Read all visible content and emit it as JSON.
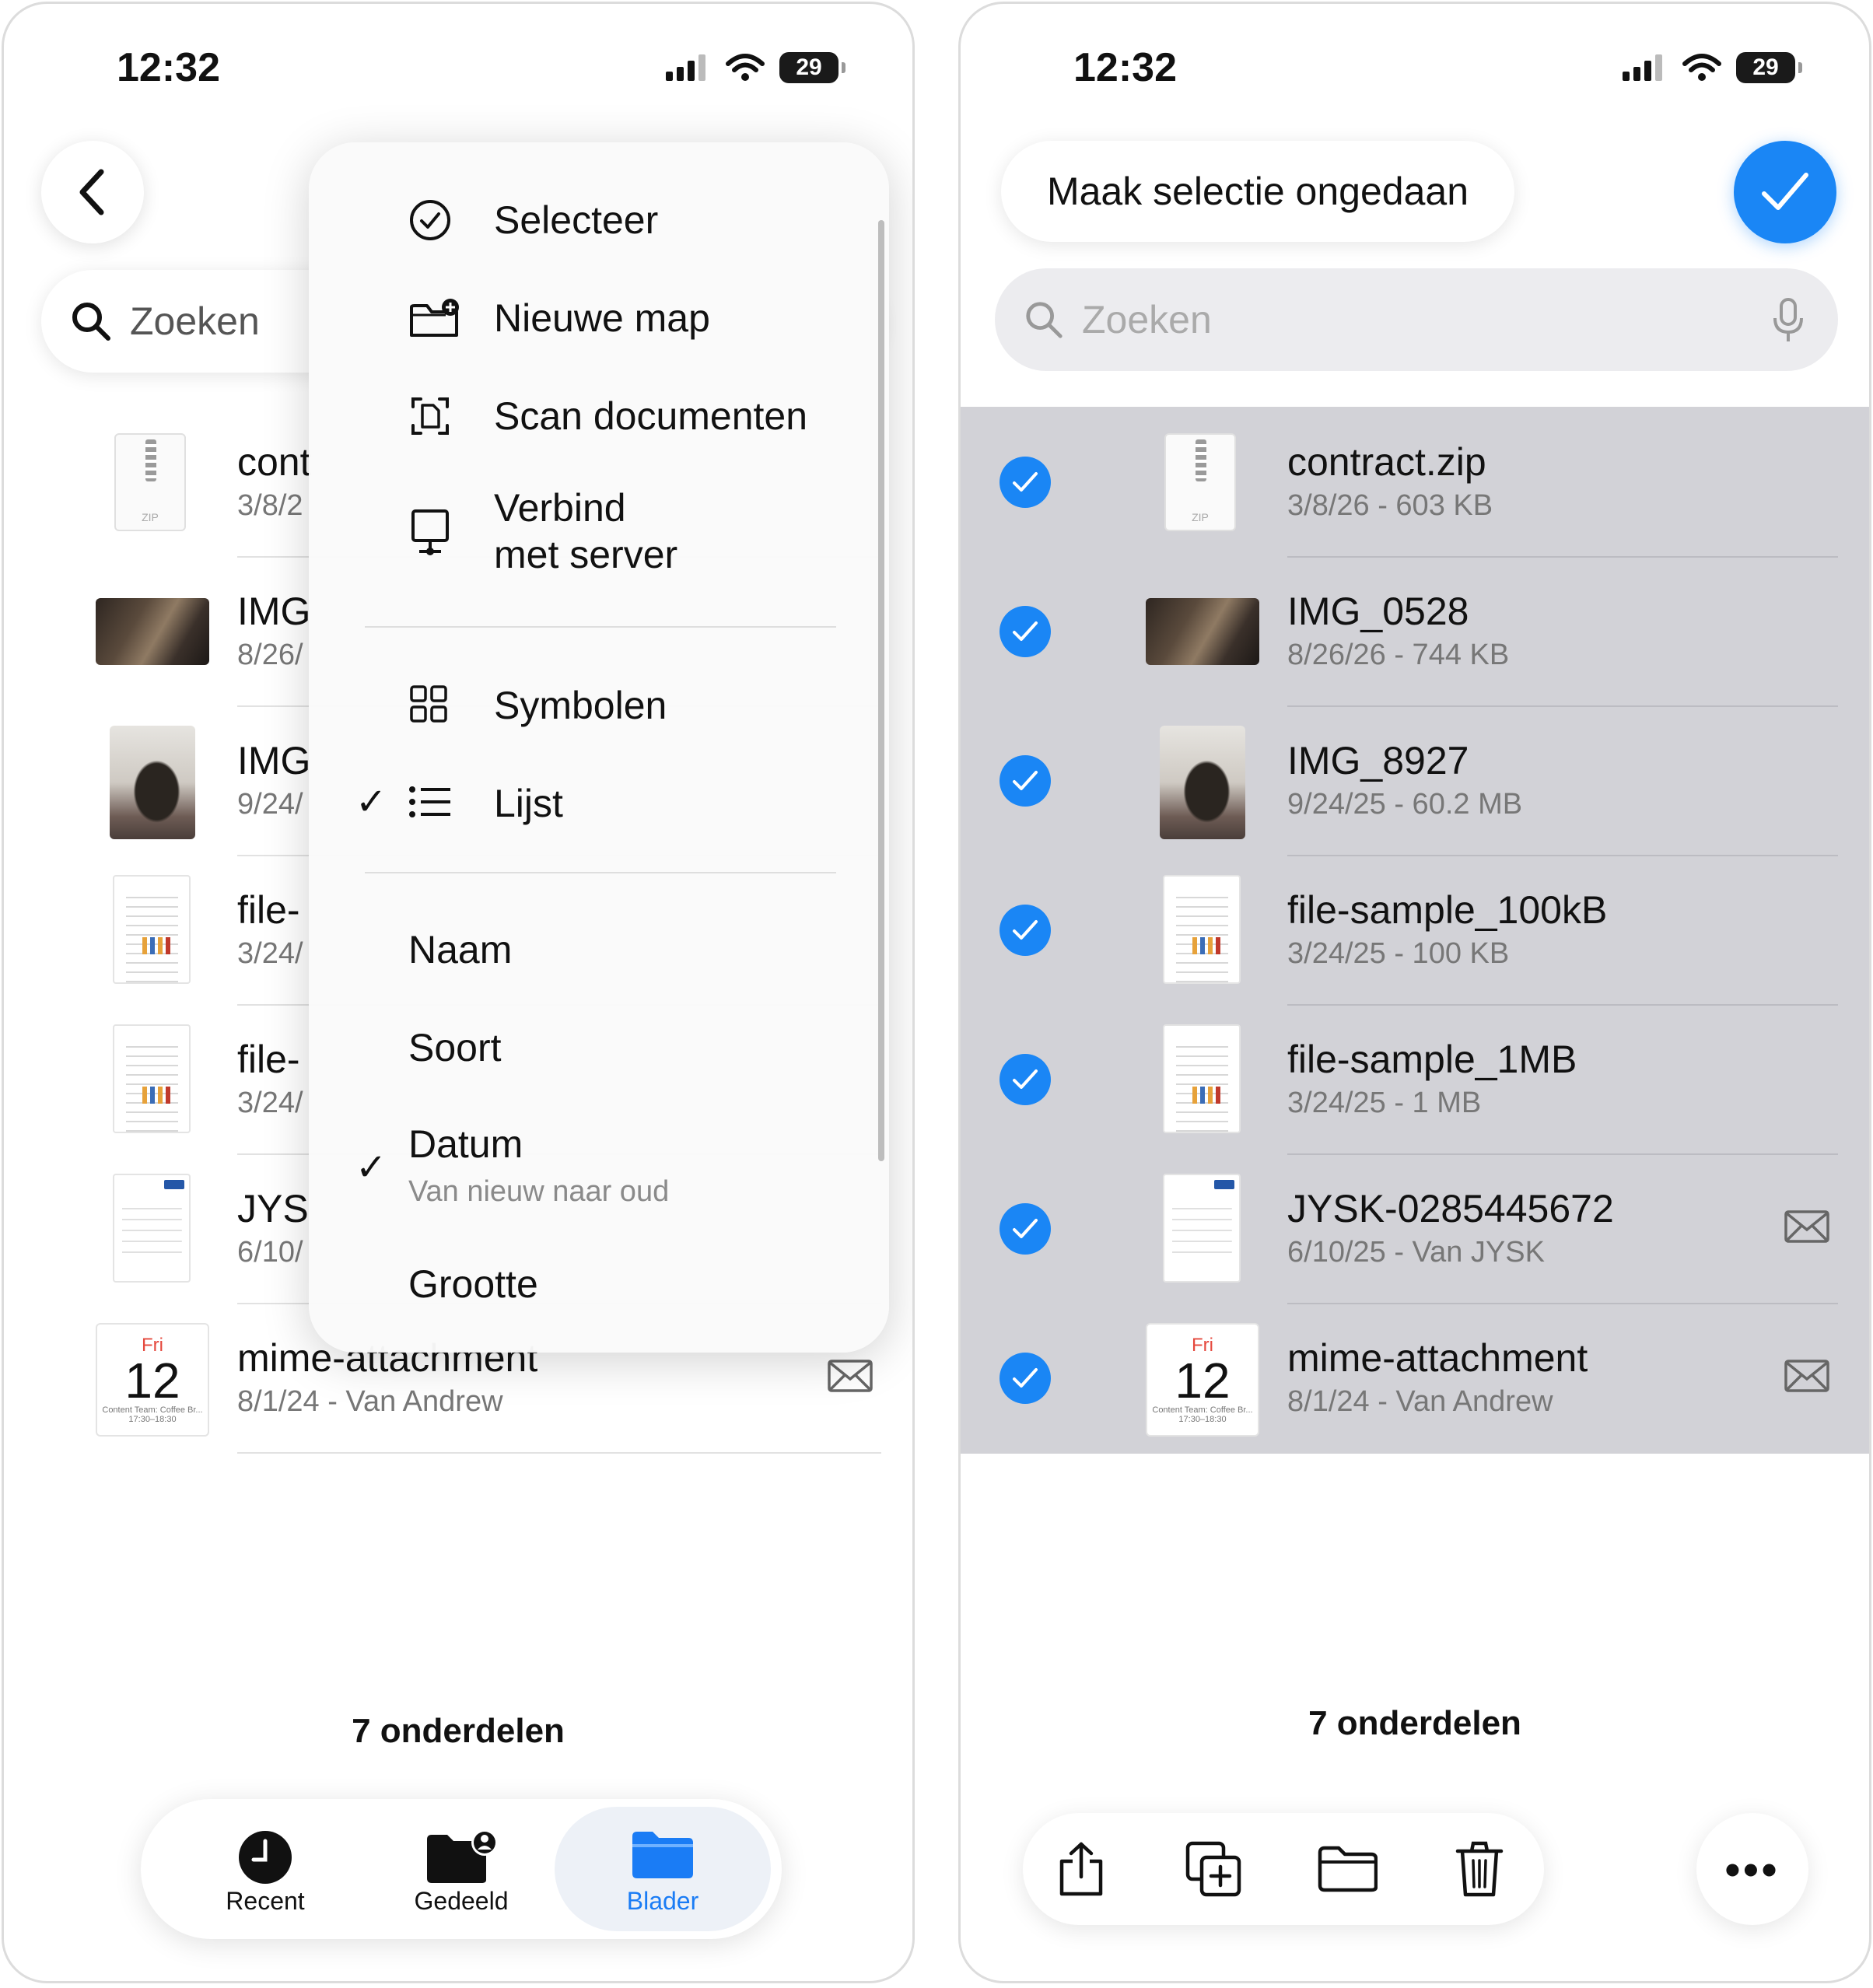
{
  "left": {
    "status": {
      "time": "12:32",
      "battery": "29"
    },
    "search": {
      "placeholder": "Zoeken"
    },
    "files": [
      {
        "name": "cont",
        "meta": "3/8/2",
        "thumb": "zip",
        "ziplabel": "ZIP"
      },
      {
        "name": "IMG",
        "meta": "8/26/",
        "thumb": "photo-wide"
      },
      {
        "name": "IMG",
        "meta": "9/24/",
        "thumb": "photo-tall"
      },
      {
        "name": "file-",
        "meta": "3/24/",
        "thumb": "doc"
      },
      {
        "name": "file-",
        "meta": "3/24/",
        "thumb": "doc"
      },
      {
        "name": "JYS",
        "meta": "6/10/",
        "thumb": "invoice"
      },
      {
        "name": "mime-attachment",
        "meta": "8/1/24 - Van Andrew",
        "thumb": "calendar"
      }
    ],
    "calendar": {
      "day": "Fri",
      "num": "12",
      "sub1": "Content Team: Coffee Br...",
      "sub2": "17:30–18:30"
    },
    "menu": {
      "select": "Selecteer",
      "new_folder": "Nieuwe map",
      "scan": "Scan documenten",
      "connect_line1": "Verbind",
      "connect_line2": "met server",
      "icons": "Symbolen",
      "list": "Lijst",
      "sort_name": "Naam",
      "sort_kind": "Soort",
      "sort_date": "Datum",
      "sort_date_sub": "Van nieuw naar oud",
      "sort_size": "Grootte",
      "check_mark": "✓"
    },
    "count": "7 onderdelen",
    "tabs": {
      "recent": "Recent",
      "shared": "Gedeeld",
      "browse": "Blader"
    }
  },
  "right": {
    "status": {
      "time": "12:32",
      "battery": "29"
    },
    "undo_label": "Maak selectie ongedaan",
    "search": {
      "placeholder": "Zoeken"
    },
    "files": [
      {
        "name": "contract.zip",
        "meta": "3/8/26 - 603 KB",
        "thumb": "zip",
        "ziplabel": "ZIP"
      },
      {
        "name": "IMG_0528",
        "meta": "8/26/26 - 744 KB",
        "thumb": "photo-wide"
      },
      {
        "name": "IMG_8927",
        "meta": "9/24/25 - 60.2 MB",
        "thumb": "photo-tall"
      },
      {
        "name": "file-sample_100kB",
        "meta": "3/24/25 - 100 KB",
        "thumb": "doc"
      },
      {
        "name": "file-sample_1MB",
        "meta": "3/24/25 - 1 MB",
        "thumb": "doc"
      },
      {
        "name": "JYSK-0285445672",
        "meta": "6/10/25 - Van JYSK",
        "thumb": "invoice"
      },
      {
        "name": "mime-attachment",
        "meta": "8/1/24 - Van Andrew",
        "thumb": "calendar"
      }
    ],
    "calendar": {
      "day": "Fri",
      "num": "12",
      "sub1": "Content Team: Coffee Br...",
      "sub2": "17:30–18:30"
    },
    "count": "7 onderdelen",
    "more": "•••"
  },
  "colors": {
    "accent": "#1a86f5",
    "selection_band": "#d2d2d7",
    "calendar_day": "#e5483d"
  },
  "icons": [
    "chevron-left-icon",
    "search-icon",
    "mic-icon",
    "checkmark-circle-icon",
    "folder-plus-icon",
    "scan-doc-icon",
    "server-icon",
    "grid-icon",
    "list-icon",
    "mail-icon",
    "clock-icon",
    "shared-folder-icon",
    "folder-icon",
    "share-icon",
    "duplicate-icon",
    "trash-icon",
    "more-icon"
  ]
}
